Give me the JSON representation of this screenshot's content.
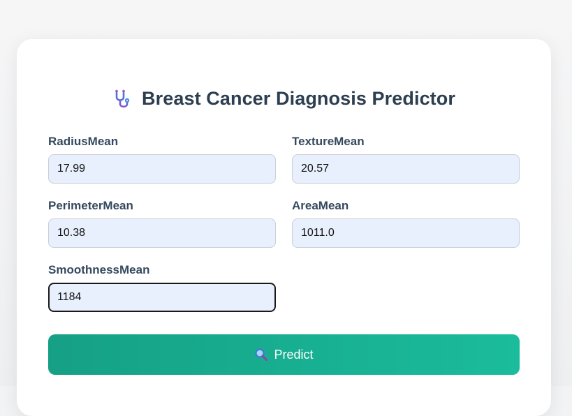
{
  "page": {
    "title": "Breast Cancer Diagnosis Predictor",
    "title_icon": "stethoscope-icon"
  },
  "form": {
    "fields": [
      {
        "label": "RadiusMean",
        "value": "17.99"
      },
      {
        "label": "TextureMean",
        "value": "20.57"
      },
      {
        "label": "PerimeterMean",
        "value": "10.38"
      },
      {
        "label": "AreaMean",
        "value": "1011.0"
      },
      {
        "label": "SmoothnessMean",
        "value": "1184"
      }
    ],
    "submit_label": "Predict",
    "submit_icon": "magnifier-icon"
  },
  "colors": {
    "title": "#2c3e50",
    "label": "#34495e",
    "input_bg": "#e8f0fe",
    "button_start": "#16a085",
    "button_end": "#1abc9c"
  }
}
